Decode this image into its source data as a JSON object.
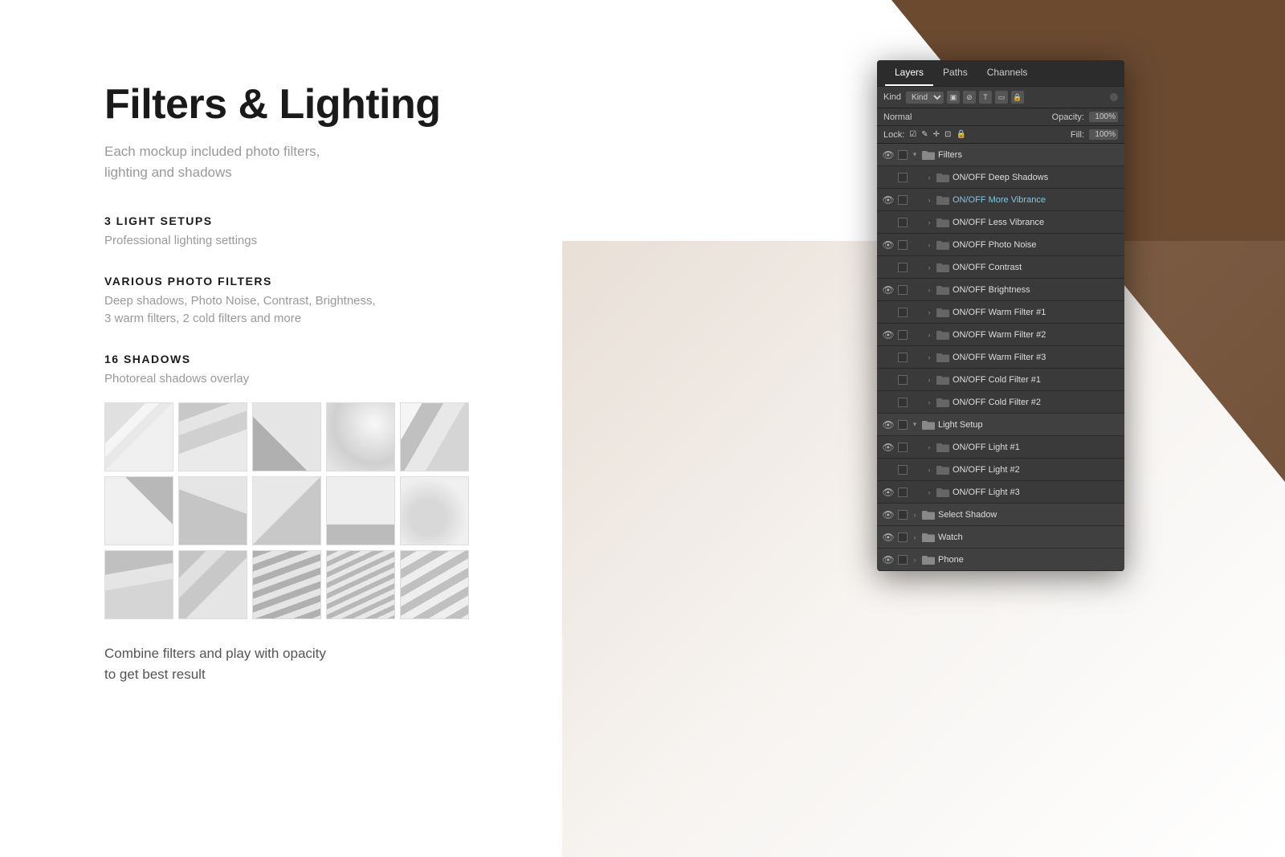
{
  "background": {
    "triangle_color": "#6b4a30"
  },
  "left": {
    "title": "Filters & Lighting",
    "subtitle": "Each mockup included photo filters,\nlighting and shadows",
    "sections": [
      {
        "heading": "3 LIGHT SETUPS",
        "desc": "Professional lighting settings"
      },
      {
        "heading": "VARIOUS PHOTO FILTERS",
        "desc": "Deep shadows, Photo Noise, Contrast, Brightness,\n3 warm filters, 2 cold filters and more"
      },
      {
        "heading": "16 SHADOWS",
        "desc": "Photoreal shadows overlay"
      }
    ],
    "combine_text": "Combine filters and play with opacity\nto get best result"
  },
  "ps_panel": {
    "tabs": [
      "Layers",
      "Paths",
      "Channels"
    ],
    "active_tab": "Layers",
    "kind_label": "Kind",
    "opacity_label": "Opacity:",
    "opacity_value": "100%",
    "fill_label": "Fill:",
    "fill_value": "100%",
    "lock_label": "Lock:",
    "layers": [
      {
        "type": "group_open",
        "visible": true,
        "name": "Filters",
        "indent": 0
      },
      {
        "type": "item",
        "visible": false,
        "name": "ON/OFF Deep Shadows",
        "indent": 1
      },
      {
        "type": "item",
        "visible": true,
        "name": "ON/OFF More Vibrance",
        "indent": 1,
        "vibrance": true
      },
      {
        "type": "item",
        "visible": false,
        "name": "ON/OFF Less Vibrance",
        "indent": 1
      },
      {
        "type": "item",
        "visible": true,
        "name": "ON/OFF Photo Noise",
        "indent": 1
      },
      {
        "type": "item",
        "visible": false,
        "name": "ON/OFF Contrast",
        "indent": 1
      },
      {
        "type": "item",
        "visible": true,
        "name": "ON/OFF Brightness",
        "indent": 1
      },
      {
        "type": "item",
        "visible": false,
        "name": "ON/OFF Warm Filter #1",
        "indent": 1
      },
      {
        "type": "item",
        "visible": true,
        "name": "ON/OFF Warm Filter #2",
        "indent": 1
      },
      {
        "type": "item",
        "visible": false,
        "name": "ON/OFF Warm Filter #3",
        "indent": 1
      },
      {
        "type": "item",
        "visible": false,
        "name": "ON/OFF Cold Filter #1",
        "indent": 1
      },
      {
        "type": "item",
        "visible": false,
        "name": "ON/OFF Cold Filter #2",
        "indent": 1
      },
      {
        "type": "group_open",
        "visible": true,
        "name": "Light Setup",
        "indent": 0
      },
      {
        "type": "item",
        "visible": true,
        "name": "ON/OFF Light #1",
        "indent": 1
      },
      {
        "type": "item",
        "visible": false,
        "name": "ON/OFF Light #2",
        "indent": 1
      },
      {
        "type": "item",
        "visible": true,
        "name": "ON/OFF Light #3",
        "indent": 1
      },
      {
        "type": "group_closed",
        "visible": true,
        "name": "Select Shadow",
        "indent": 0
      },
      {
        "type": "group_closed",
        "visible": true,
        "name": "Watch",
        "indent": 0
      },
      {
        "type": "group_closed",
        "visible": true,
        "name": "Phone",
        "indent": 0
      }
    ]
  }
}
